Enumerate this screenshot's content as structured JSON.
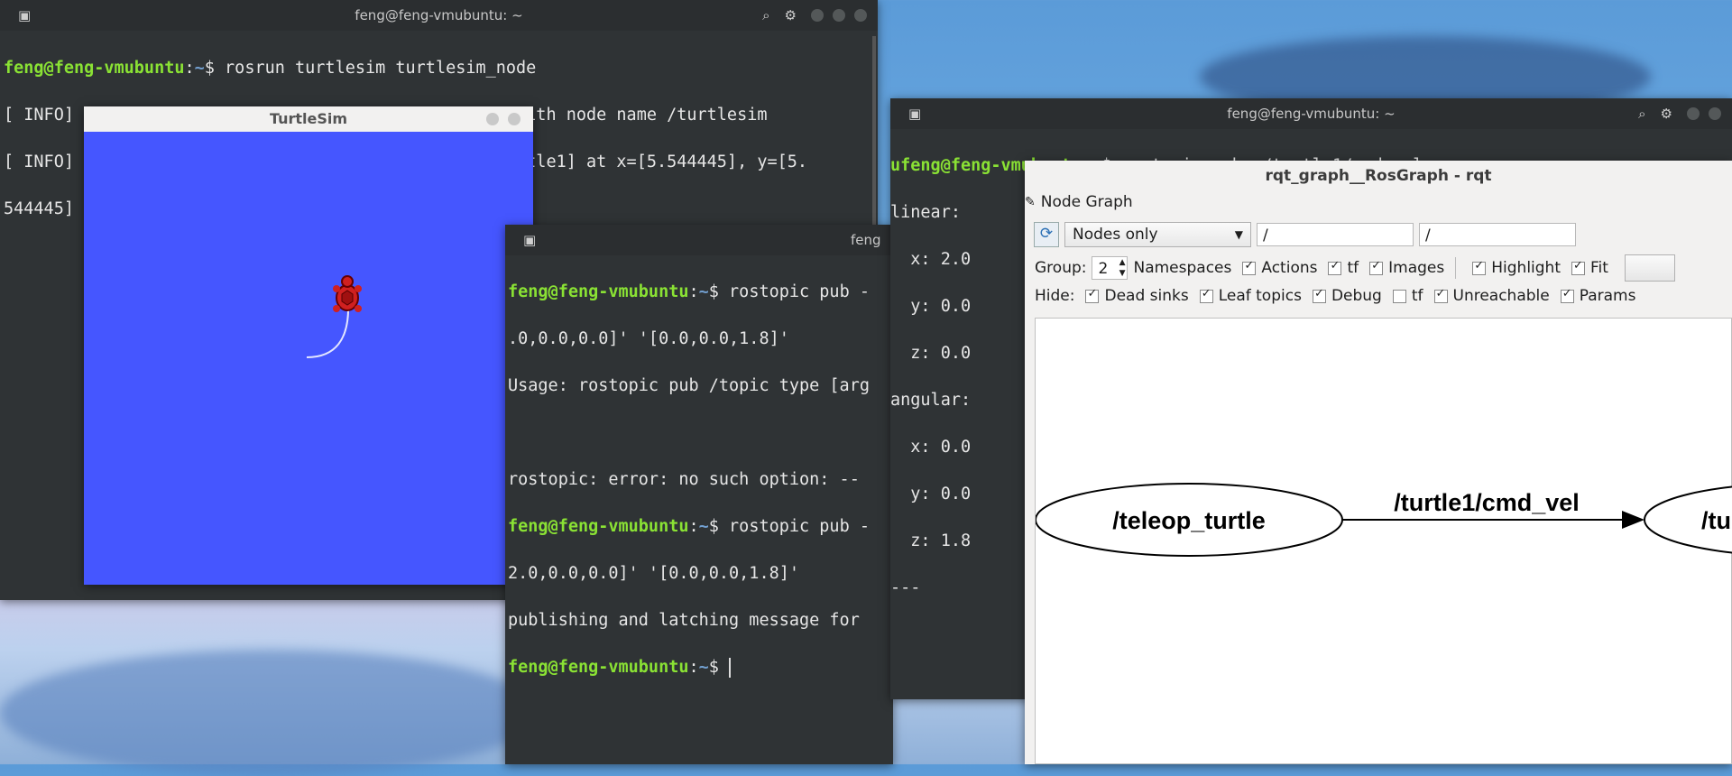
{
  "terminal1": {
    "title": "feng@feng-vmubuntu: ~",
    "prompt_user": "feng@feng-vmubuntu",
    "prompt_sep": ":",
    "prompt_path": "~",
    "prompt_dollar": "$ ",
    "command": "rosrun turtlesim turtlesim_node",
    "lines": [
      "[ INFO] [1651475333.742228299]: Starting turtlesim with node name /turtlesim",
      "[ INFO] [1651475333.748659721]: Spawning turtle [turtle1] at x=[5.544445], y=[5.",
      "544445]"
    ]
  },
  "turtlesim": {
    "title": "TurtleSim"
  },
  "terminal2": {
    "title": "feng",
    "prompt_user": "feng@feng-vmubuntu",
    "prompt_sep": ":",
    "prompt_path": "~",
    "prompt_dollar": "$ ",
    "cmd1": "rostopic pub -",
    "cmd1_cont": ".0,0.0,0.0]' '[0.0,0.0,1.8]'",
    "usage": "Usage: rostopic pub /topic type [arg",
    "error": "rostopic: error: no such option: --",
    "cmd2": "rostopic pub -",
    "cmd2_cont": "2.0,0.0,0.0]' '[0.0,0.0,1.8]'",
    "publishing": "publishing and latching message for"
  },
  "terminal3": {
    "title": "feng@feng-vmubuntu: ~",
    "prompt_prefix": "u",
    "prompt_user": "feng@feng-vmubuntu",
    "prompt_sep": ":",
    "prompt_path": "~",
    "prompt_dollar": "$ ",
    "command": "rostopic echo /turtle1/cmd_vel",
    "lines": [
      "linear:",
      "  x: 2.0",
      "  y: 0.0",
      "  z: 0.0",
      "angular:",
      "  x: 0.0",
      "  y: 0.0",
      "  z: 1.8",
      "---"
    ]
  },
  "rqt": {
    "title": "rqt_graph__RosGraph - rqt",
    "plugin_label": "Node Graph",
    "mode_select": "Nodes only",
    "filter1": "/",
    "filter2": "/",
    "group_label": "Group:",
    "group_value": "2",
    "namespaces": "Namespaces",
    "actions": "Actions",
    "tf": "tf",
    "images": "Images",
    "highlight": "Highlight",
    "fit": "Fit",
    "hide_label": "Hide:",
    "dead_sinks": "Dead sinks",
    "leaf_topics": "Leaf topics",
    "debug": "Debug",
    "tf2": "tf",
    "unreachable": "Unreachable",
    "params": "Params",
    "node1": "/teleop_turtle",
    "edge": "/turtle1/cmd_vel",
    "node2": "/tur"
  },
  "icons": {
    "terminal_menu": "terminal-menu-icon",
    "search": "search-icon",
    "settings": "gear-icon",
    "refresh": "refresh-icon"
  },
  "colors": {
    "turtle_bg": "#4556ff",
    "prompt_green": "#8ae234",
    "prompt_blue": "#729fcf"
  }
}
